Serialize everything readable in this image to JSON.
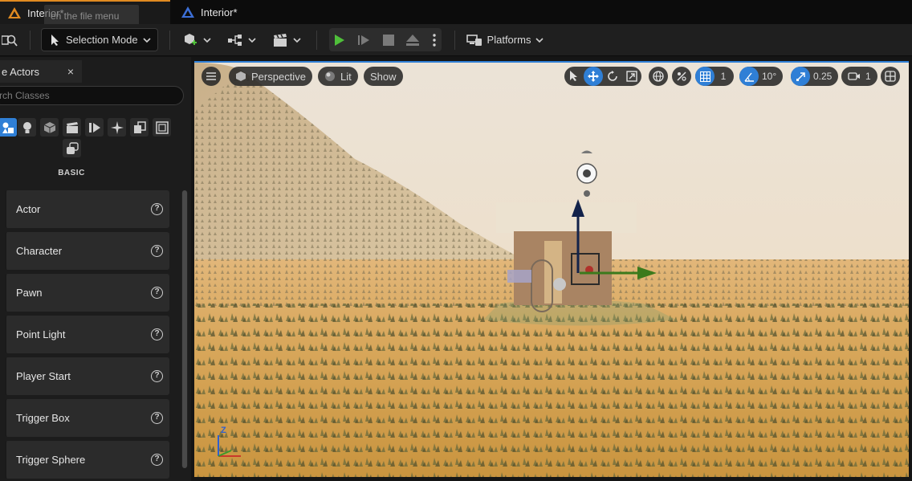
{
  "tabs": {
    "tab1": "Interior*",
    "tab2": "Interior*",
    "tooltip": "en the file menu"
  },
  "toolbar": {
    "mode": "Selection Mode",
    "platforms": "Platforms"
  },
  "panel": {
    "tab_label": "e Actors",
    "close": "×",
    "search_placeholder": "rch Classes",
    "category": "BASIC",
    "items": [
      "Actor",
      "Character",
      "Pawn",
      "Point Light",
      "Player Start",
      "Trigger Box",
      "Trigger Sphere"
    ],
    "help_glyph": "?"
  },
  "viewport": {
    "perspective": "Perspective",
    "lit": "Lit",
    "show": "Show",
    "grid_value": "1",
    "angle_value": "10°",
    "scale_value": "0.25",
    "camera_value": "1",
    "gizmo_z": "Z"
  },
  "colors": {
    "accent_blue": "#2f7fd6",
    "play_green": "#4fbf3a",
    "tab_orange": "#e08a21"
  }
}
